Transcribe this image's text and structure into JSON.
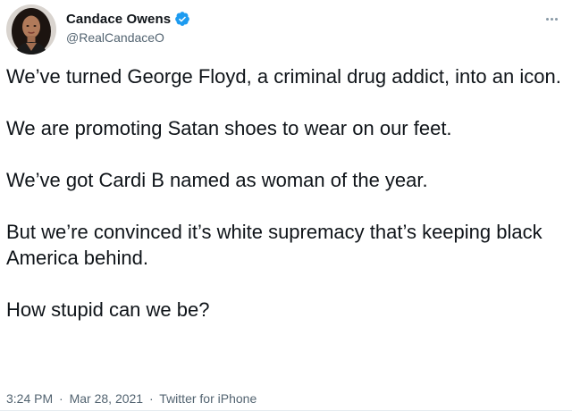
{
  "tweet": {
    "author": {
      "display_name": "Candace Owens",
      "handle": "@RealCandaceO",
      "verified": true,
      "avatar_icon": "profile-photo-icon"
    },
    "more_icon": "more-options-icon",
    "paragraphs": [
      "We’ve turned George Floyd, a criminal drug addict, into an icon.",
      "We are promoting Satan shoes to wear on our feet.",
      "We’ve got Cardi B named as woman of the year.",
      "But we’re convinced it’s white supremacy that’s keeping black America behind.",
      "How stupid can we be?"
    ],
    "meta": {
      "time": "3:24 PM",
      "date": "Mar 28, 2021",
      "source": "Twitter for iPhone",
      "separator": "·"
    }
  },
  "colors": {
    "text": "#0f1419",
    "muted": "#536471",
    "verified_badge": "#1d9bf0"
  }
}
